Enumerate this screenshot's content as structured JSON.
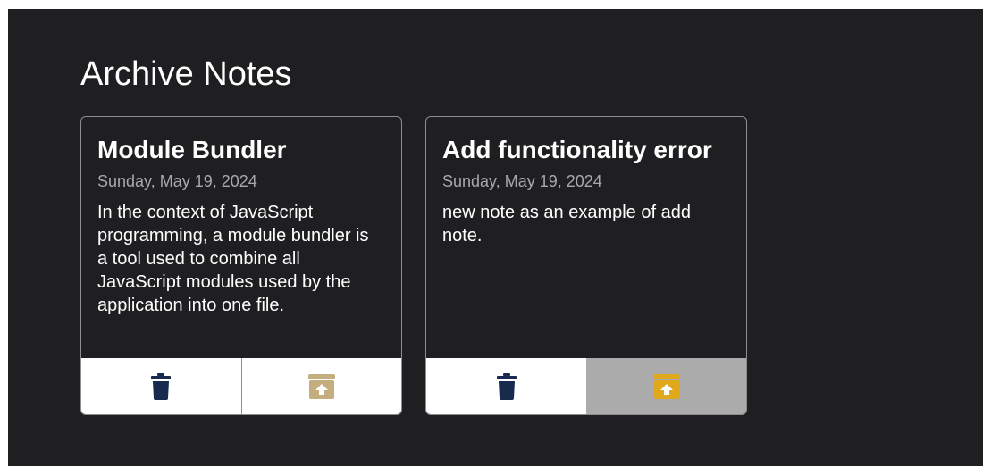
{
  "page": {
    "title": "Archive Notes"
  },
  "notes": [
    {
      "title": "Module Bundler",
      "date": "Sunday, May 19, 2024",
      "body": "In the context of JavaScript programming, a module bundler is a tool used to combine all JavaScript modules used by the application into one file.",
      "delete_icon": "trash-icon",
      "unarchive_icon": "unarchive-icon"
    },
    {
      "title": "Add functionality error",
      "date": "Sunday, May 19, 2024",
      "body": "new note as an example of add note.",
      "delete_icon": "trash-icon",
      "unarchive_icon": "unarchive-icon"
    }
  ],
  "colors": {
    "background": "#1f1f22",
    "delete_icon": "#182a4e",
    "unarchive_icon_default": "#c4ad7f",
    "unarchive_icon_hover": "#e0a81b",
    "hover_button_bg": "#ababab"
  }
}
